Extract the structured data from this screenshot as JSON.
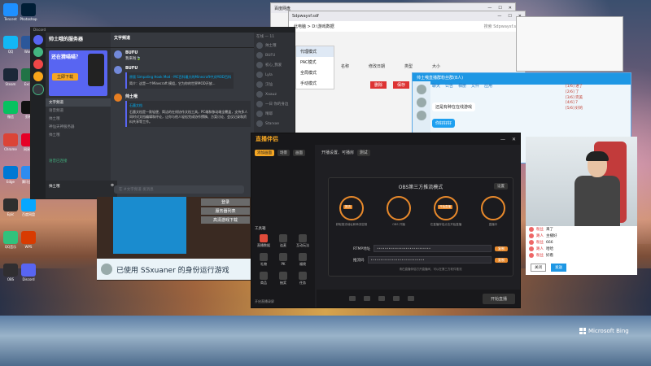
{
  "discord": {
    "app_title": "Discord",
    "server_name": "帅土哦的服务器",
    "banner_title": "还在猜喵喵？",
    "banner_button": "立即下载",
    "channels": [
      "文字频道",
      "语音频道",
      "帅土哦",
      "神仙天神服务器",
      "帅土哦"
    ],
    "voice_status": "语音已连接",
    "user_name": "帅土哦",
    "channel_header": "文字频道",
    "messages": [
      {
        "name": "BUFU",
        "text": "我来啦🍃"
      },
      {
        "name": "BUFU",
        "text": "",
        "embed_title": "原版 Simpaling Hook Mod - MC百科最大的Minecraft中文MOD百科",
        "embed_desc": "简介：这是一个Minecraft 模组，它为你的世界MOD开放..."
      },
      {
        "name": "帅土哦",
        "text": "",
        "embed_title": "石墨文档",
        "embed_desc": "石墨文档是一款轻便、简洁的在线协作文档工具，PC端和移动端全覆盖，支持多人同时对文档编辑和评论，让你与他人轻松完成协作撰稿、方案讨论、会议记录和资料共享等工作。"
      }
    ],
    "input_placeholder": "在 #文字频道 发消息",
    "members_header": "在线 — 11",
    "members": [
      "帅土哦",
      "BUFU",
      "初心_我爱",
      "Lyla",
      "汉仙",
      "Xaauz",
      "一日 你的身边",
      "晴耶",
      "Starxxe"
    ]
  },
  "game": {
    "menu": [
      "登录",
      "服务器列表",
      "高清游戏下载"
    ],
    "notice": "已使用 SSxuaner 的身份运行游戏"
  },
  "explorer_back": {
    "title": "百度网盘"
  },
  "explorer_front": {
    "title": "Sdpwaysf.sdf",
    "path": "此电脑 > D:\\游戏数据",
    "search": "搜索 Sdpwaysf.sdf",
    "menu_items": [
      "代理模式",
      "PAC模式",
      "全局模式",
      "手动模式"
    ],
    "columns": [
      "名称",
      "修改日期",
      "类型",
      "大小"
    ],
    "actions": [
      "删除",
      "保存"
    ]
  },
  "qq": {
    "title": "帅土哦直播群粉丝群(8人)",
    "tabs": [
      "聊天",
      "公告",
      "相册",
      "文件",
      "应用"
    ],
    "bubbles": [
      "还是有种在在线游戏",
      "你好好好"
    ],
    "side_notes": [
      "[1/6] 进了",
      "[2/6] 了",
      "[3/6] 完美",
      "[4/6] 7",
      "[5/6] 好的"
    ]
  },
  "danmu": {
    "rows": [
      {
        "name": "粉丝",
        "text": "来了"
      },
      {
        "name": "路人",
        "text": "主播好"
      },
      {
        "name": "粉丝",
        "text": "666"
      },
      {
        "name": "路人",
        "text": "哈哈"
      },
      {
        "name": "粉丝",
        "text": "好看"
      }
    ],
    "buttons": [
      "关闭",
      "发送"
    ]
  },
  "live": {
    "app_name": "直播伴侣",
    "status_text": "开播设置、可播房",
    "status_pill": "测试",
    "left_tabs": [
      "添加画面",
      "场景",
      "画面"
    ],
    "mode_title": "OBS第三方推流模式",
    "settings_btn": "设置",
    "steps": [
      {
        "tag": "推流",
        "label": "获取推流地址和串流密钥"
      },
      {
        "tag": "",
        "label": "OBS 开播"
      },
      {
        "tag": "开始直播",
        "label": "在直播伴侣点击开始直播"
      },
      {
        "tag": "",
        "label": "直播中"
      }
    ],
    "stream_url_label": "RTMP地址",
    "stream_url_value": "••••••••••••••••••••••••••••",
    "stream_key_label": "推流码",
    "stream_key_value": "••••••••••••••••••••••••••••",
    "copy_label": "复制",
    "hint": "请在直播伴侣打开直播间，可以在第三方软件推流",
    "tools": [
      "直播数据",
      "连麦",
      "互动玩法",
      "礼物",
      "PK",
      "福袋",
      "商品",
      "抽奖",
      "任务"
    ],
    "tools_header": "工具箱",
    "start_button": "开始直播",
    "bottom_checkbox": "开启直播录屏"
  },
  "desktop_icons": [
    "Tencent",
    "QQ",
    "Steam",
    "微信",
    "Chrome",
    "Edge",
    "Epic",
    "QQ音乐",
    "OBS",
    "Photoshop",
    "Word",
    "Excel",
    "剪映",
    "网易云",
    "腾讯会议",
    "百度网盘",
    "WPS",
    "Discord"
  ],
  "watermark": "Microsoft Bing"
}
